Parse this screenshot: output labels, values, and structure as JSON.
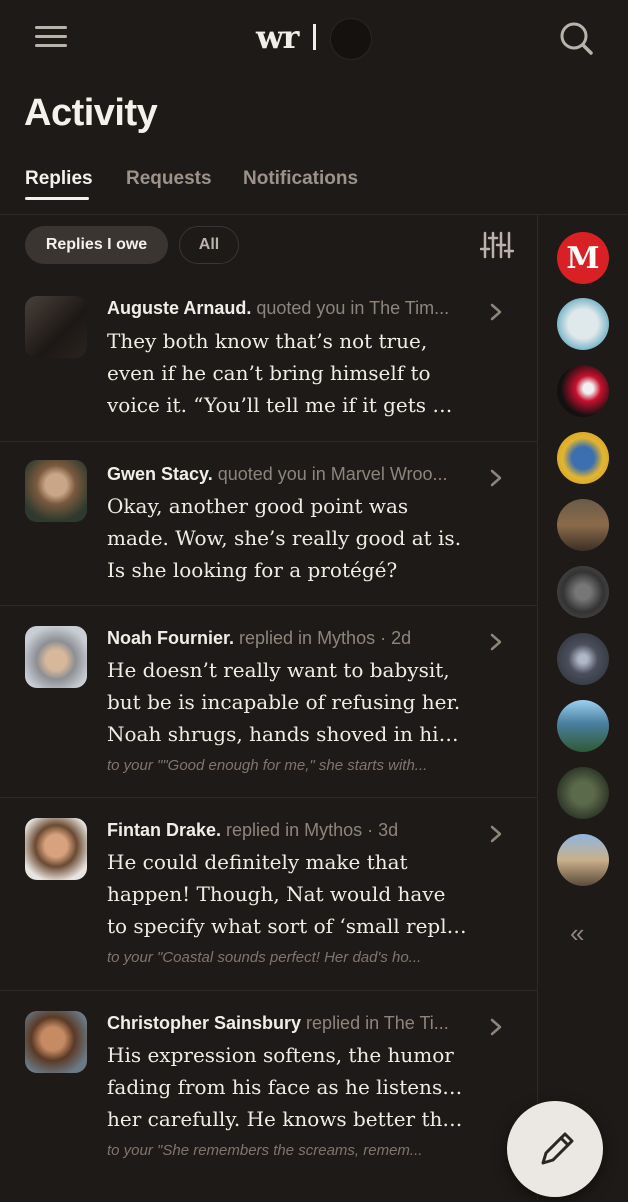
{
  "header": {
    "logo_text": "wr",
    "menu_icon": "hamburger-menu-icon",
    "search_icon": "search-icon"
  },
  "page": {
    "title": "Activity"
  },
  "tabs": [
    {
      "label": "Replies",
      "active": true
    },
    {
      "label": "Requests",
      "active": false
    },
    {
      "label": "Notifications",
      "active": false
    }
  ],
  "filters": {
    "selected_label": "Replies I owe",
    "other_label": "All",
    "settings_icon": "sliders-icon"
  },
  "replies": [
    {
      "name": "Auguste Arnaud.",
      "action": " quoted you in The Tim...",
      "lines": [
        "They both know that’s not true,",
        "even if he can’t bring himself to",
        "voice it. “You’ll tell me if it gets wo..."
      ],
      "context": ""
    },
    {
      "name": "Gwen Stacy.",
      "action": " quoted you in Marvel Wroo...",
      "lines": [
        "Okay, another good point was",
        "made. Wow, she’s really good at is.",
        "Is she looking for a protégé?"
      ],
      "context": ""
    },
    {
      "name": "Noah Fournier.",
      "action": " replied in Mythos · 2d",
      "lines": [
        "He doesn’t really want to babysit,",
        "but be is incapable of refusing her.",
        "Noah shrugs, hands shoved in his ..."
      ],
      "context": "to your \"\"Good enough for me,\" she starts with..."
    },
    {
      "name": "Fintan Drake.",
      "action": " replied in Mythos · 3d",
      "lines": [
        "He could definitely make that",
        "happen! Though, Nat would have",
        "to specify what sort of ‘small repli..."
      ],
      "context": "to your \"Coastal sounds perfect! Her dad's ho..."
    },
    {
      "name": "Christopher Sainsbury",
      "action": " replied in The Ti...",
      "lines": [
        "His expression softens, the humor",
        "fading from his face as he listens to",
        "her carefully. He knows better tha..."
      ],
      "context": "to your \"She remembers the screams, remem..."
    }
  ],
  "sidebar": {
    "avatars": [
      "community-avatar-1",
      "community-avatar-2",
      "community-avatar-3",
      "community-avatar-4",
      "community-avatar-5",
      "community-avatar-6",
      "community-avatar-7",
      "community-avatar-8",
      "community-avatar-9",
      "community-avatar-10"
    ],
    "first_badge_letter": "M",
    "collapse_label": "«"
  },
  "fab": {
    "icon": "pencil-icon"
  },
  "colors": {
    "background": "#1e1a17",
    "text": "#f1ede8",
    "muted": "#8c857c",
    "fab": "#ebe7e2",
    "badge_red": "#d92024"
  }
}
